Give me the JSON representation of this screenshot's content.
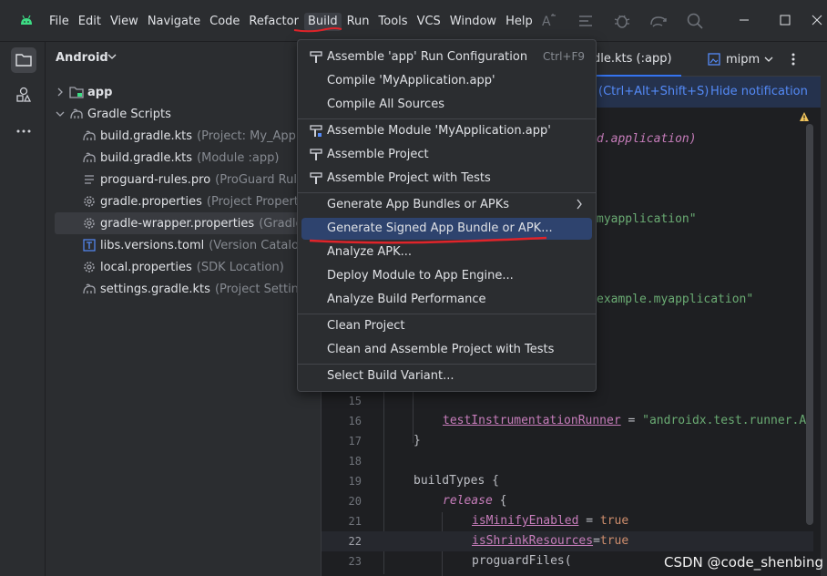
{
  "menubar": {
    "items": [
      "File",
      "Edit",
      "View",
      "Navigate",
      "Code",
      "Refactor",
      "Build",
      "Run",
      "Tools",
      "VCS",
      "Window",
      "Help"
    ]
  },
  "colors": {
    "accent": "#3574f0",
    "annotation": "#e0242a",
    "android": "#3ddc84",
    "highlight": "#2e436e"
  },
  "project": {
    "view_label": "Android",
    "tree": [
      {
        "label": "app",
        "hint": "",
        "icon": "module-folder-icon"
      },
      {
        "label": "Gradle Scripts",
        "hint": "",
        "icon": "gradle-elephant-icon"
      },
      {
        "label": "build.gradle.kts",
        "hint": "(Project: My_Applica",
        "icon": "gradle-elephant-icon"
      },
      {
        "label": "build.gradle.kts",
        "hint": "(Module :app)",
        "icon": "gradle-elephant-icon"
      },
      {
        "label": "proguard-rules.pro",
        "hint": "(ProGuard Rule",
        "icon": "text-file-icon"
      },
      {
        "label": "gradle.properties",
        "hint": "(Project Propertie",
        "icon": "settings-gear-icon"
      },
      {
        "label": "gradle-wrapper.properties",
        "hint": "(Gradle",
        "icon": "settings-gear-icon"
      },
      {
        "label": "libs.versions.toml",
        "hint": "(Version Catalog)",
        "icon": "toml-file-icon"
      },
      {
        "label": "local.properties",
        "hint": "(SDK Location)",
        "icon": "settings-gear-icon"
      },
      {
        "label": "settings.gradle.kts",
        "hint": "(Project Settings)",
        "icon": "gradle-elephant-icon"
      }
    ]
  },
  "editor": {
    "tabs": [
      {
        "label": "dle.kts (:app)"
      },
      {
        "label": "mipm"
      }
    ],
    "notification": {
      "shortcut_link": "(Ctrl+Alt+Shift+S)",
      "hide_link": "Hide notification"
    },
    "code": {
      "frag1": "d.application)",
      "frag2": "myapplication\"",
      "frag3": "example.myapplication\"",
      "line15": "15",
      "line16": "16",
      "line17": "17",
      "line18": "18",
      "line19": "19",
      "line20": "20",
      "line21": "21",
      "line22": "22",
      "line23": "23",
      "test_runner_key": "testInstrumentationRunner",
      "eq": " = ",
      "test_runner_val": "\"androidx.test.runner.A",
      "close_brace": "}",
      "build_types": "buildTypes {",
      "release_kw": "release",
      "release_brace": " {",
      "minify_key": "isMinifyEnabled",
      "minify_eq": " = ",
      "minify_val": "true",
      "shrink_key": "isShrinkResources",
      "shrink_eq": "=",
      "shrink_val": "true",
      "proguard": "proguardFiles("
    }
  },
  "build_menu": {
    "items": [
      {
        "label": "Assemble 'app' Run Configuration",
        "shortcut": "Ctrl+F9",
        "icon": "hammer-icon"
      },
      {
        "label": "Compile 'MyApplication.app'",
        "shortcut": "",
        "icon": ""
      },
      {
        "label": "Compile All Sources",
        "shortcut": "",
        "icon": ""
      },
      {
        "label": "Assemble Module 'MyApplication.app'",
        "shortcut": "",
        "icon": "hammer-module-icon"
      },
      {
        "label": "Assemble Project",
        "shortcut": "",
        "icon": "hammer-icon"
      },
      {
        "label": "Assemble Project with Tests",
        "shortcut": "",
        "icon": "hammer-icon"
      },
      {
        "label": "Generate App Bundles or APKs",
        "shortcut": "",
        "icon": ""
      },
      {
        "label": "Generate Signed App Bundle or APK...",
        "shortcut": "",
        "icon": ""
      },
      {
        "label": "Analyze APK...",
        "shortcut": "",
        "icon": ""
      },
      {
        "label": "Deploy Module to App Engine...",
        "shortcut": "",
        "icon": ""
      },
      {
        "label": "Analyze Build Performance",
        "shortcut": "",
        "icon": ""
      },
      {
        "label": "Clean Project",
        "shortcut": "",
        "icon": ""
      },
      {
        "label": "Clean and Assemble Project with Tests",
        "shortcut": "",
        "icon": ""
      },
      {
        "label": "Select Build Variant...",
        "shortcut": "",
        "icon": ""
      }
    ]
  },
  "watermark": "CSDN @code_shenbing"
}
